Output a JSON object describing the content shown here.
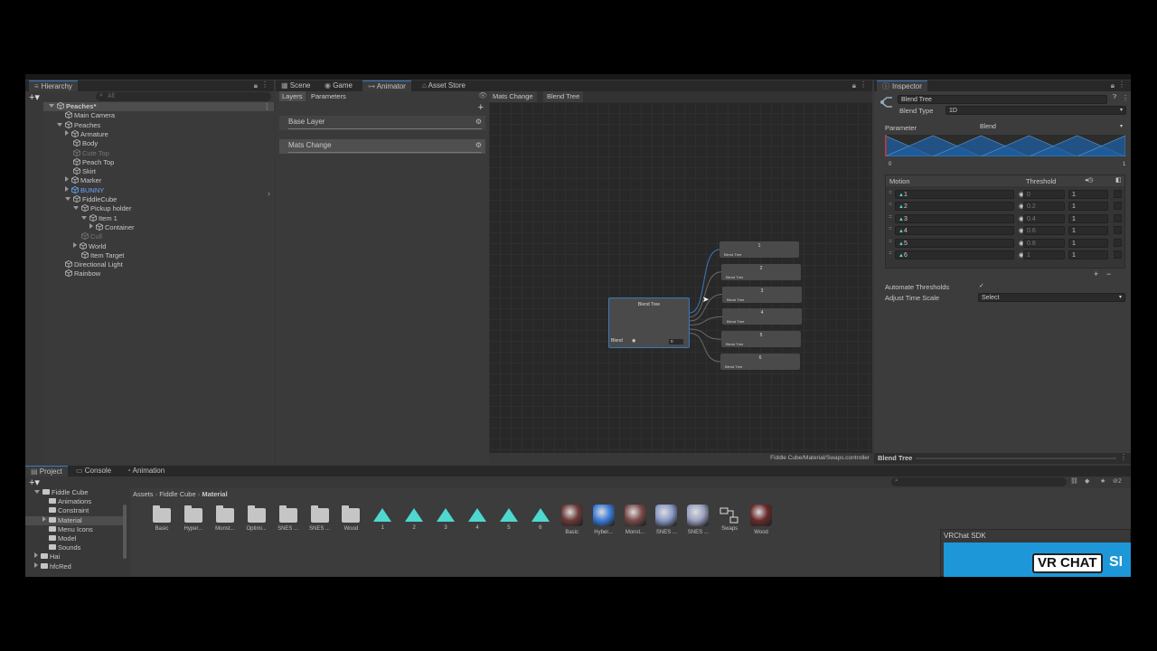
{
  "hierarchy": {
    "title": "Hierarchy",
    "search_placeholder": "All",
    "items": [
      {
        "label": "Peaches*",
        "depth": 0
      },
      {
        "label": "Main Camera",
        "depth": 1
      },
      {
        "label": "Peaches",
        "depth": 1
      },
      {
        "label": "Armature",
        "depth": 2
      },
      {
        "label": "Body",
        "depth": 2
      },
      {
        "label": "Cute Top",
        "depth": 2
      },
      {
        "label": "Peach Top",
        "depth": 2
      },
      {
        "label": "Skirt",
        "depth": 2
      },
      {
        "label": "Marker",
        "depth": 2
      },
      {
        "label": "BUNNY",
        "depth": 2
      },
      {
        "label": "FiddleCube",
        "depth": 2
      },
      {
        "label": "Pickup holder",
        "depth": 3
      },
      {
        "label": "Item 1",
        "depth": 4
      },
      {
        "label": "Container",
        "depth": 5
      },
      {
        "label": "Cull",
        "depth": 3
      },
      {
        "label": "World",
        "depth": 3
      },
      {
        "label": "Item Target",
        "depth": 3
      },
      {
        "label": "Directional Light",
        "depth": 1
      },
      {
        "label": "Rainbow",
        "depth": 1
      }
    ]
  },
  "center_tabs": [
    "Scene",
    "Game",
    "Animator",
    "Asset Store"
  ],
  "animator": {
    "left_tabs": [
      "Layers",
      "Parameters"
    ],
    "layers": [
      "Base Layer",
      "Mats Change"
    ],
    "breadcrumb": [
      "Mats Change",
      "Blend Tree"
    ],
    "root_node": {
      "title": "Blend Tree",
      "param": "Blend",
      "value": "0"
    },
    "children": [
      {
        "title": "1",
        "sub": "Blend Tree"
      },
      {
        "title": "2",
        "sub": "Blend Tree"
      },
      {
        "title": "3",
        "sub": "Blend Tree"
      },
      {
        "title": "4",
        "sub": "Blend Tree"
      },
      {
        "title": "5",
        "sub": "Blend Tree"
      },
      {
        "title": "6",
        "sub": "Blend Tree"
      }
    ],
    "status_path": "Fiddle Cube/Material/Swaps.controller"
  },
  "inspector": {
    "title": "Inspector",
    "name": "Blend Tree",
    "blend_type_label": "Blend Type",
    "blend_type_value": "1D",
    "parameter_label": "Parameter",
    "parameter_value": "Blend",
    "graph_min": "0",
    "graph_max": "1",
    "motion_header": "Motion",
    "threshold_header": "Threshold",
    "motions": [
      {
        "name": "1",
        "threshold": "0",
        "speed": "1"
      },
      {
        "name": "2",
        "threshold": "0.2",
        "speed": "1"
      },
      {
        "name": "3",
        "threshold": "0.4",
        "speed": "1"
      },
      {
        "name": "4",
        "threshold": "0.6",
        "speed": "1"
      },
      {
        "name": "5",
        "threshold": "0.8",
        "speed": "1"
      },
      {
        "name": "6",
        "threshold": "1",
        "speed": "1"
      }
    ],
    "automate_label": "Automate Thresholds",
    "automate_checked": "✓",
    "adjust_label": "Adjust Time Scale",
    "adjust_value": "Select",
    "preview_title": "Blend Tree"
  },
  "bottom_tabs": [
    "Project",
    "Console",
    "Animation"
  ],
  "project": {
    "folders": [
      {
        "label": "Fiddle Cube",
        "depth": 0
      },
      {
        "label": "Animations",
        "depth": 1
      },
      {
        "label": "Constraint",
        "depth": 1
      },
      {
        "label": "Material",
        "depth": 1
      },
      {
        "label": "Menu Icons",
        "depth": 1
      },
      {
        "label": "Model",
        "depth": 1
      },
      {
        "label": "Sounds",
        "depth": 1
      },
      {
        "label": "Hai",
        "depth": 0
      },
      {
        "label": "hfcRed",
        "depth": 0
      }
    ],
    "breadcrumb": [
      "Assets",
      "Fiddle Cube",
      "Material"
    ],
    "hidden_count": "2",
    "assets": [
      {
        "label": "Basic",
        "kind": "folder"
      },
      {
        "label": "Hyper...",
        "kind": "folder"
      },
      {
        "label": "Monst...",
        "kind": "folder"
      },
      {
        "label": "Optimi...",
        "kind": "folder"
      },
      {
        "label": "SNES ...",
        "kind": "folder"
      },
      {
        "label": "SNES ...",
        "kind": "folder"
      },
      {
        "label": "Wood",
        "kind": "folder"
      },
      {
        "label": "1",
        "kind": "blendtree"
      },
      {
        "label": "2",
        "kind": "blendtree"
      },
      {
        "label": "3",
        "kind": "blendtree"
      },
      {
        "label": "4",
        "kind": "blendtree"
      },
      {
        "label": "5",
        "kind": "blendtree"
      },
      {
        "label": "6",
        "kind": "blendtree"
      },
      {
        "label": "Basic",
        "kind": "material",
        "color": "#6a3a36"
      },
      {
        "label": "Hyber...",
        "kind": "material",
        "color": "#3a7ad8"
      },
      {
        "label": "Monst...",
        "kind": "material",
        "color": "#7a4a4a"
      },
      {
        "label": "SNES ...",
        "kind": "material",
        "color": "#8a9ac8"
      },
      {
        "label": "SNES ...",
        "kind": "material",
        "color": "#9aa0c0"
      },
      {
        "label": "Swaps",
        "kind": "controller"
      },
      {
        "label": "Wood",
        "kind": "material",
        "color": "#6a2a2a"
      }
    ]
  },
  "vrchat": {
    "title": "VRChat SDK",
    "logo": "VR CHAT",
    "logo_suffix": "SI"
  },
  "colors": {
    "accent": "#3a79bb",
    "panel": "#383838",
    "graph": "#282828",
    "blend_fill": "#1f5fa0",
    "teal": "#4fd8d0"
  }
}
